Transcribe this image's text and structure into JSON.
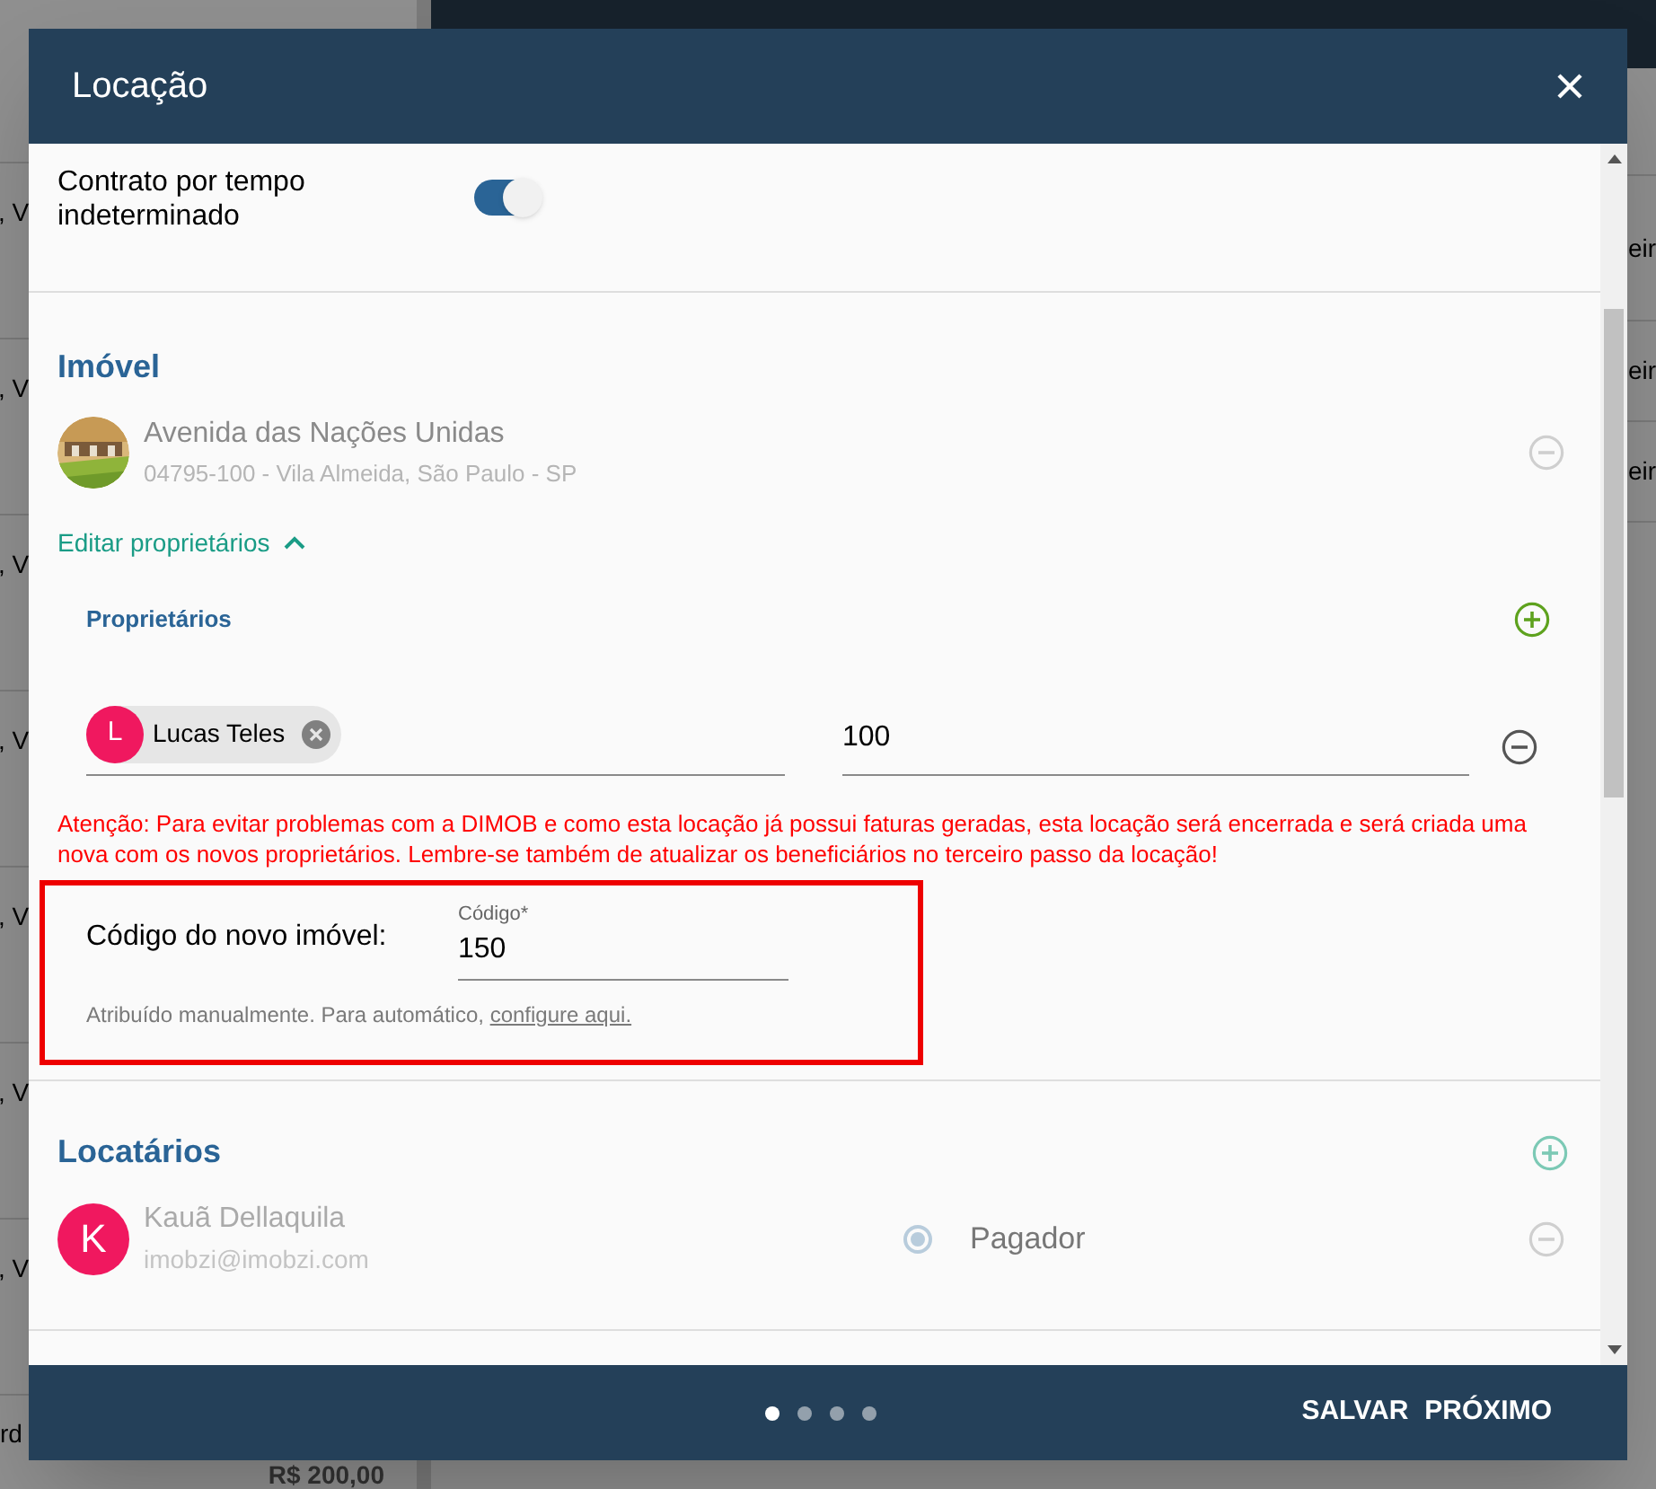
{
  "backdrop": {
    "left_rows": [
      ", V",
      ", V",
      ", V",
      ", V",
      ", V",
      ", V",
      ", V"
    ],
    "bottom_row": {
      "text": "rd",
      "amount": "R$ 200,00"
    },
    "right_texts": [
      "eir",
      "eir",
      "eir"
    ]
  },
  "dialog": {
    "title": "Locação",
    "contract_toggle": {
      "label": "Contrato por tempo indeterminado",
      "on": true
    },
    "property_section": {
      "title": "Imóvel",
      "property": {
        "name": "Avenida das Nações Unidas",
        "address": "04795-100 - Vila Almeida, São Paulo - SP"
      },
      "edit_owners": {
        "label": "Editar proprietários",
        "expanded": true
      },
      "owners": {
        "title": "Proprietários",
        "rows": [
          {
            "initial": "L",
            "name": "Lucas Teles",
            "share": "100"
          }
        ]
      },
      "warning": "Atenção: Para evitar problemas com a DIMOB e como esta locação já possui faturas geradas, esta locação será encerrada e será criada uma nova com os novos proprietários. Lembre-se também de atualizar os beneficiários no terceiro passo da locação!",
      "new_code": {
        "label": "Código do novo imóvel:",
        "field_label": "Código*",
        "value": "150",
        "hint": "Atribuído manualmente. Para automático,",
        "hint_link": "configure aqui."
      }
    },
    "tenants_section": {
      "title": "Locatários",
      "tenants": [
        {
          "initial": "K",
          "name": "Kauã Dellaquila",
          "email": "imobzi@imobzi.com",
          "payer_selected": true,
          "role": "Pagador"
        }
      ]
    },
    "steps": [
      {
        "selected": true
      },
      {
        "selected": false
      },
      {
        "selected": false
      },
      {
        "selected": false
      }
    ],
    "buttons": [
      "SALVAR",
      "PRÓXIMO"
    ]
  }
}
